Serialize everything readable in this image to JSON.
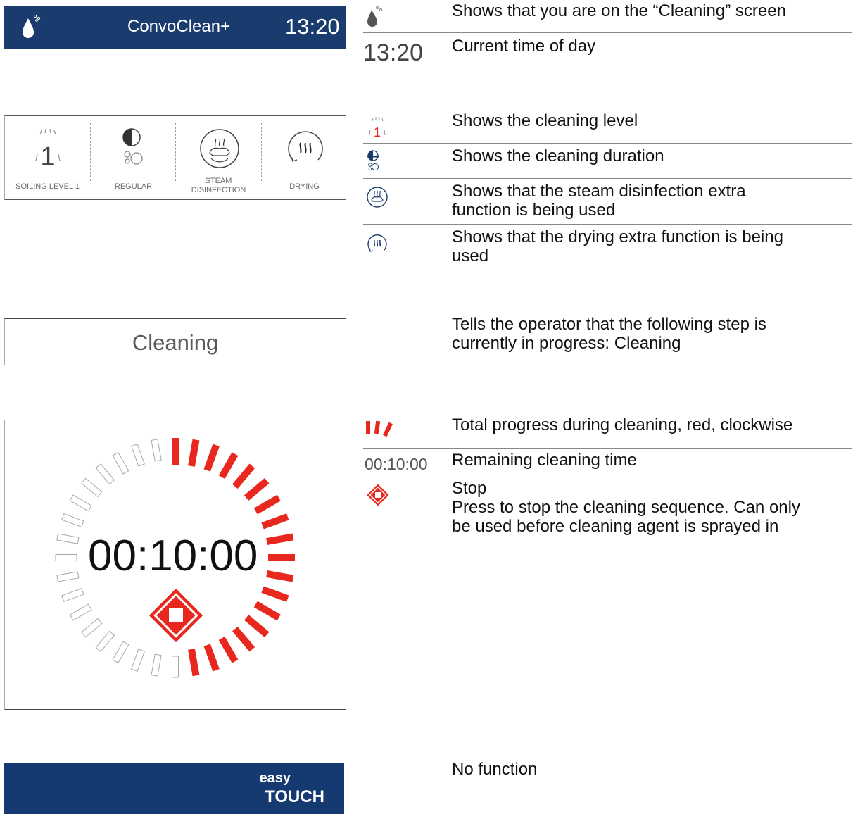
{
  "screen": {
    "app_title": "ConvoClean+",
    "time": "13:20",
    "info_labels": {
      "soiling": "SOILING LEVEL 1",
      "soiling_digit": "1",
      "regular": "REGULAR",
      "steam_line1": "STEAM",
      "steam_line2": "DISINFECTION",
      "drying": "DRYING"
    },
    "step_name": "Cleaning",
    "remaining_time": "00:10:00",
    "progress_fraction": 0.5,
    "logo_top": "easy",
    "logo_bottom": "TOUCH"
  },
  "legend": {
    "cleaning_screen": "Shows that you are on the “Cleaning” screen",
    "time_icon_text": "13:20",
    "time_of_day": "Current time of day",
    "level_digit": "1",
    "cleaning_level": "Shows the cleaning level",
    "cleaning_duration": "Shows the cleaning duration",
    "steam_line1": "Shows that the steam disinfection extra",
    "steam_line2": "function is being used",
    "drying_line1": "Shows that the drying extra function is being",
    "drying_line2": "used",
    "step_line1": "Tells the operator that the following step is",
    "step_line2": "currently in progress: Cleaning",
    "progress": "Total progress during cleaning, red, clockwise",
    "remaining_icon_text": "00:10:00",
    "remaining": "Remaining cleaning time",
    "stop_title": "Stop",
    "stop_line1": "Press to stop the cleaning sequence. Can only",
    "stop_line2": "be used before cleaning agent is sprayed in",
    "footer": "No function"
  },
  "colors": {
    "header_blue": "#1a3b6e",
    "footer_blue": "#153a72",
    "progress_red": "#e8281f",
    "inactive_segment": "#ffffff"
  },
  "icons": [
    "drop-icon",
    "soiling-level-icon",
    "duration-icon",
    "steam-disinfection-icon",
    "drying-icon",
    "progress-segments-icon",
    "stop-icon"
  ]
}
